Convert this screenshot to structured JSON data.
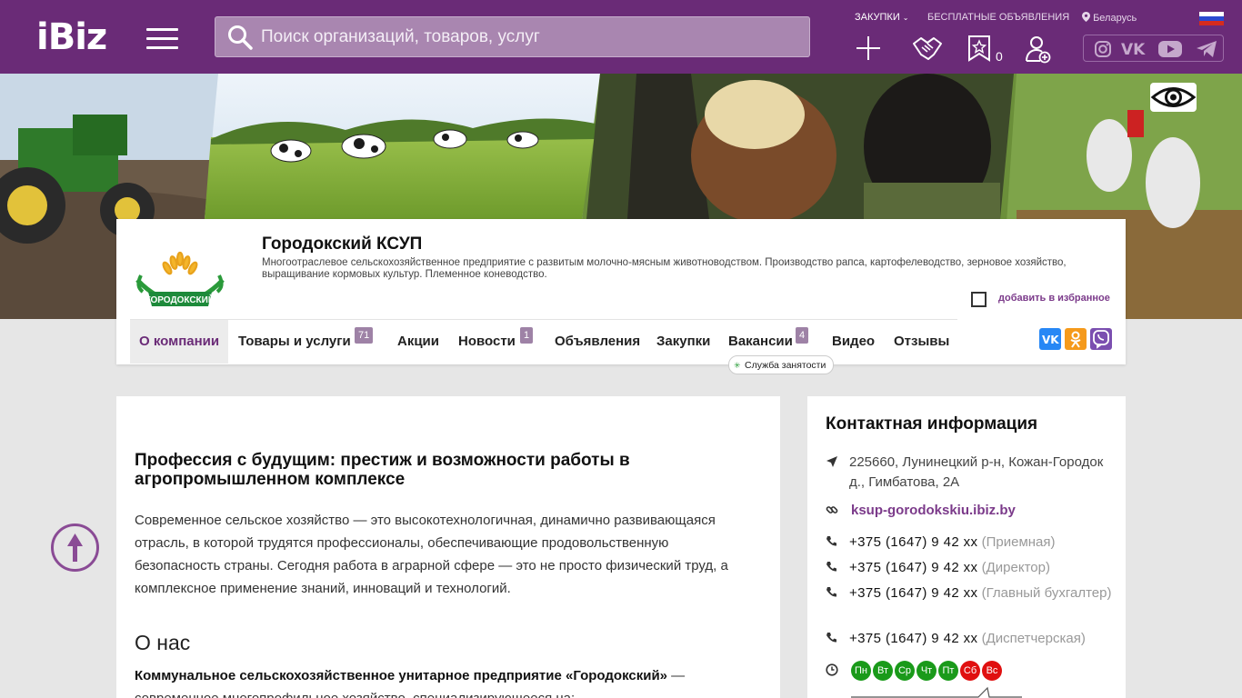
{
  "header": {
    "logo": "iBiz",
    "search_placeholder": "Поиск организаций, товаров, услуг",
    "nav": {
      "purchases": "ЗАКУПКИ",
      "free_ads": "БЕСПЛАТНЫЕ ОБЪЯВЛЕНИЯ",
      "region": "Беларусь"
    },
    "favorites_count": "0",
    "accent": "#6a2b77"
  },
  "company": {
    "name": "Городокский КСУП",
    "description": "Многоотраслевое сельскохозяйственное предприятие с развитым молочно-мясным животноводством. Производство рапса, картофелеводство, зерновое хозяйство, выращивание кормовых культур. Племенное коневодство.",
    "logo_text": "ГОРОДОКСКИЙ",
    "favorite_label": "добавить в избранное"
  },
  "tabs": [
    {
      "label": "О компании"
    },
    {
      "label": "Товары и услуги",
      "badge": "71"
    },
    {
      "label": "Акции"
    },
    {
      "label": "Новости",
      "badge": "1"
    },
    {
      "label": "Объявления"
    },
    {
      "label": "Закупки"
    },
    {
      "label": "Вакансии",
      "badge": "4"
    },
    {
      "label": "Видео"
    },
    {
      "label": "Отзывы"
    }
  ],
  "vacancy_sub_badge": "Служба занятости",
  "share": {
    "vk": "vk",
    "ok": "ok",
    "viber": "viber"
  },
  "article": {
    "title": "Профессия с будущим: престиж и возможности работы в агропромышленном комплексе",
    "lead": "Современное сельское хозяйство — это высокотехнологичная, динамично развивающаяся отрасль, в которой трудятся профессионалы, обеспечивающие продовольственную безопасность страны. Сегодня работа в аграрной сфере — это не просто физический труд, а комплексное применение знаний, инноваций и технологий.",
    "about_heading": "О нас",
    "about_bold": "Коммунальное сельскохозяйственное унитарное предприятие «Городокский»",
    "about_rest": " — современное многопрофильное хозяйство, специализирующееся на:"
  },
  "contacts": {
    "title": "Контактная информация",
    "address": "225660, Лунинецкий р-н, Кожан-Городок д., Гимбатова, 2А",
    "site": "ksup-gorodokskiu.ibiz.by",
    "phones": [
      {
        "number": "+375 (1647) 9 42 xx",
        "note": "(Приемная)"
      },
      {
        "number": "+375 (1647) 9 42 xx",
        "note": "(Директор)"
      },
      {
        "number": "+375 (1647) 9 42 xx",
        "note": "(Главный бухгалтер)"
      },
      {
        "number": "+375 (1647) 9 42 xx",
        "note": "(Диспетчерская)"
      }
    ],
    "days": [
      {
        "label": "Пн",
        "color": "#1a9a1a"
      },
      {
        "label": "Вт",
        "color": "#1a9a1a"
      },
      {
        "label": "Ср",
        "color": "#1a9a1a"
      },
      {
        "label": "Чт",
        "color": "#1a9a1a"
      },
      {
        "label": "Пт",
        "color": "#1a9a1a"
      },
      {
        "label": "Сб",
        "color": "#e01010"
      },
      {
        "label": "Вс",
        "color": "#e01010"
      }
    ]
  }
}
